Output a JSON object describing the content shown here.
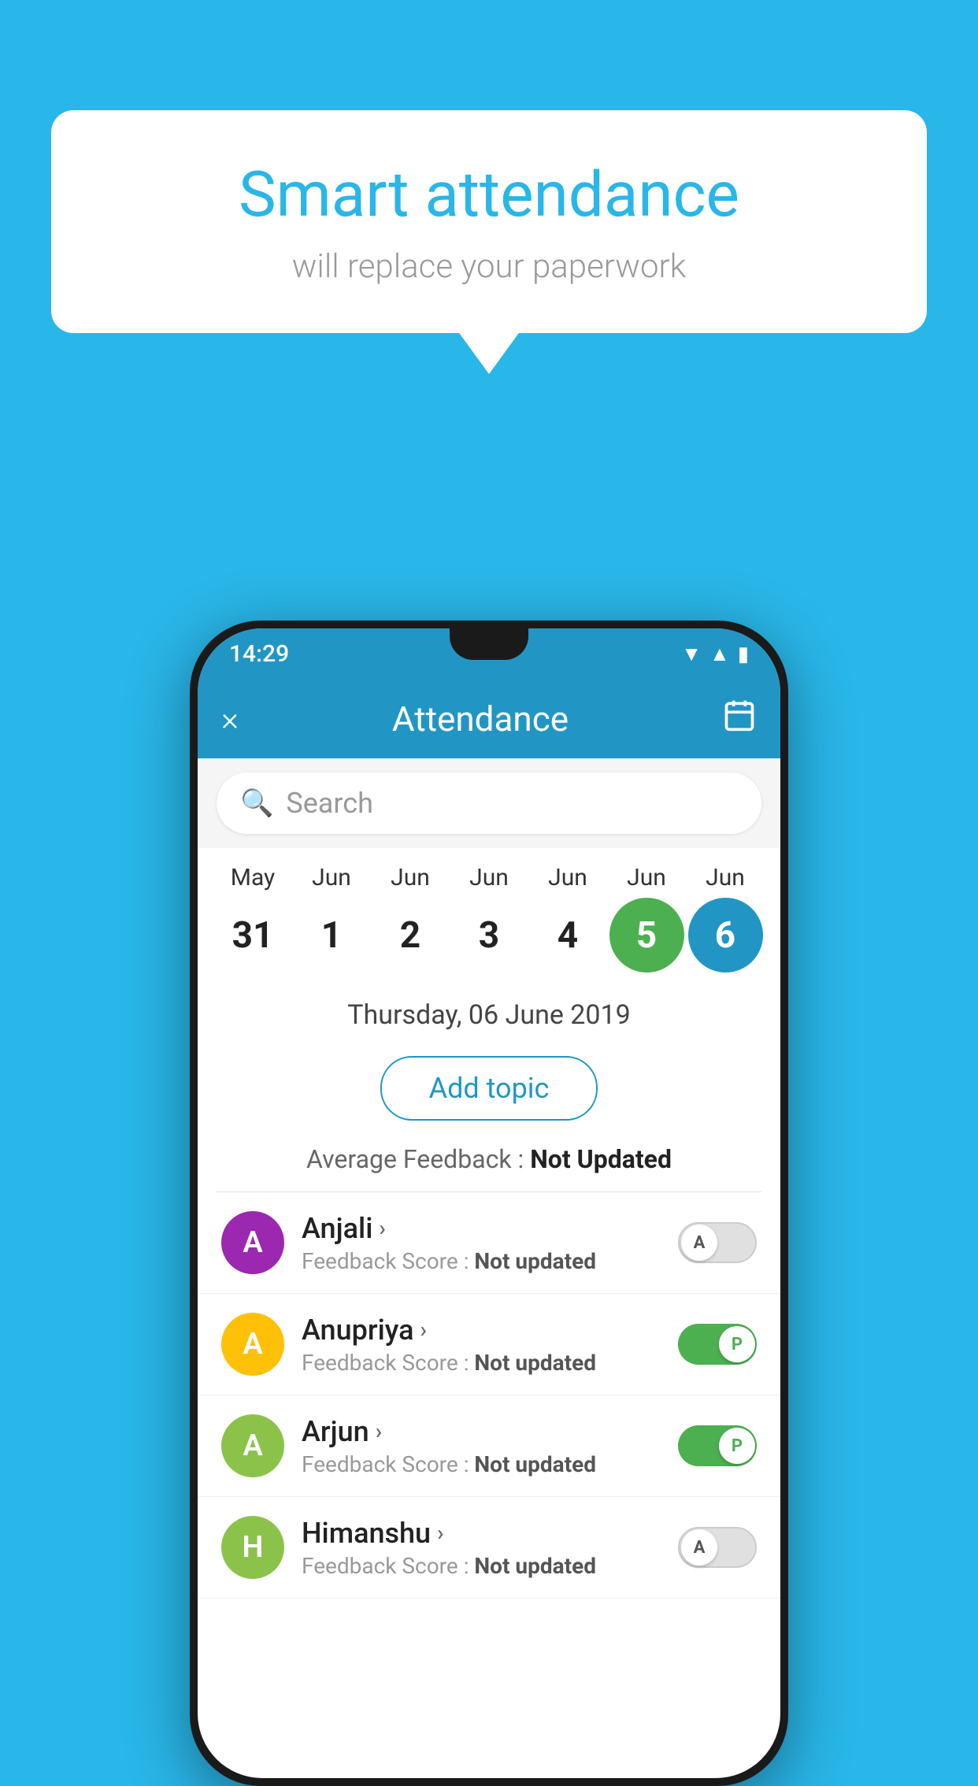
{
  "background_color": "#29b6e8",
  "speech_bubble": {
    "title": "Smart attendance",
    "subtitle": "will replace your paperwork"
  },
  "status_bar": {
    "time": "14:29",
    "icons": [
      "wifi",
      "signal",
      "battery"
    ]
  },
  "app_bar": {
    "title": "Attendance",
    "close_icon": "×",
    "calendar_icon": "📅"
  },
  "search": {
    "placeholder": "Search"
  },
  "calendar": {
    "months": [
      "May",
      "Jun",
      "Jun",
      "Jun",
      "Jun",
      "Jun",
      "Jun"
    ],
    "dates": [
      "31",
      "1",
      "2",
      "3",
      "4",
      "5",
      "6"
    ],
    "today_index": 5,
    "selected_index": 6
  },
  "selected_date": "Thursday, 06 June 2019",
  "add_topic_label": "Add topic",
  "feedback_summary": {
    "label": "Average Feedback : ",
    "value": "Not Updated"
  },
  "students": [
    {
      "name": "Anjali",
      "avatar_letter": "A",
      "avatar_color": "#9c27b0",
      "feedback": "Feedback Score : ",
      "feedback_value": "Not updated",
      "toggle_state": "off",
      "toggle_label": "A"
    },
    {
      "name": "Anupriya",
      "avatar_letter": "A",
      "avatar_color": "#ffc107",
      "feedback": "Feedback Score : ",
      "feedback_value": "Not updated",
      "toggle_state": "on",
      "toggle_label": "P"
    },
    {
      "name": "Arjun",
      "avatar_letter": "A",
      "avatar_color": "#8bc34a",
      "feedback": "Feedback Score : ",
      "feedback_value": "Not updated",
      "toggle_state": "on",
      "toggle_label": "P"
    },
    {
      "name": "Himanshu",
      "avatar_letter": "H",
      "avatar_color": "#8bc34a",
      "feedback": "Feedback Score : ",
      "feedback_value": "Not updated",
      "toggle_state": "off",
      "toggle_label": "A"
    }
  ]
}
